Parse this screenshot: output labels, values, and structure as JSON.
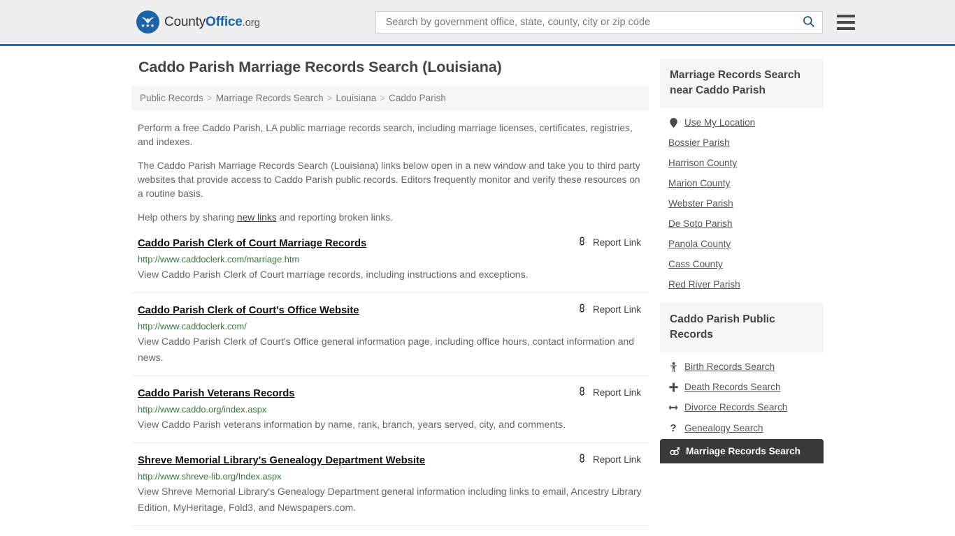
{
  "header": {
    "logo": {
      "icon": "eagle-shield-icon",
      "text_county": "County",
      "text_office": "Office",
      "text_org": ".org",
      "stars": "★★★"
    },
    "search": {
      "placeholder": "Search by government office, state, county, city or zip code",
      "value": "",
      "button_icon": "search-icon"
    },
    "menu_icon": "hamburger-menu-icon"
  },
  "page_title": "Caddo Parish Marriage Records Search (Louisiana)",
  "breadcrumb": {
    "separator": ">",
    "items": [
      {
        "label": "Public Records"
      },
      {
        "label": "Marriage Records Search"
      },
      {
        "label": "Louisiana"
      },
      {
        "label": "Caddo Parish"
      }
    ]
  },
  "intro": {
    "p1": "Perform a free Caddo Parish, LA public marriage records search, including marriage licenses, certificates, registries, and indexes.",
    "p2": "The Caddo Parish Marriage Records Search (Louisiana) links below open in a new window and take you to third party websites that provide access to Caddo Parish public records. Editors frequently monitor and verify these resources on a routine basis.",
    "p3_prefix": "Help others by sharing ",
    "p3_link": "new links",
    "p3_suffix": " and reporting broken links."
  },
  "report_link_label": "Report Link",
  "report_link_icon": "chain-broken-icon",
  "results": [
    {
      "title": "Caddo Parish Clerk of Court Marriage Records",
      "url": "http://www.caddoclerk.com/marriage.htm",
      "description": "View Caddo Parish Clerk of Court marriage records, including instructions and exceptions."
    },
    {
      "title": "Caddo Parish Clerk of Court's Office Website",
      "url": "http://www.caddoclerk.com/",
      "description": "View Caddo Parish Clerk of Court's Office general information page, including office hours, contact information and news."
    },
    {
      "title": "Caddo Parish Veterans Records",
      "url": "http://www.caddo.org/index.aspx",
      "description": "View Caddo Parish veterans information by name, rank, branch, years served, city, and comments."
    },
    {
      "title": "Shreve Memorial Library's Genealogy Department Website",
      "url": "http://www.shreve-lib.org/Index.aspx",
      "description": "View Shreve Memorial Library's Genealogy Department general information including links to email, Ancestry Library Edition, MyHeritage, Fold3, and Newspapers.com."
    }
  ],
  "sidebar": {
    "nearby": {
      "heading": "Marriage Records Search near Caddo Parish",
      "items": [
        {
          "label": "Use My Location",
          "icon": "map-pin-icon"
        },
        {
          "label": "Bossier Parish",
          "icon": ""
        },
        {
          "label": "Harrison County",
          "icon": ""
        },
        {
          "label": "Marion County",
          "icon": ""
        },
        {
          "label": "Webster Parish",
          "icon": ""
        },
        {
          "label": "De Soto Parish",
          "icon": ""
        },
        {
          "label": "Panola County",
          "icon": ""
        },
        {
          "label": "Cass County",
          "icon": ""
        },
        {
          "label": "Red River Parish",
          "icon": ""
        }
      ]
    },
    "public_records": {
      "heading": "Caddo Parish Public Records",
      "items": [
        {
          "label": "Birth Records Search",
          "icon": "child-icon",
          "glyph": "\u0001",
          "active": false
        },
        {
          "label": "Death Records Search",
          "icon": "plus-cross-icon",
          "glyph": "+",
          "active": false
        },
        {
          "label": "Divorce Records Search",
          "icon": "arrows-horizontal-icon",
          "glyph": "↔",
          "active": false
        },
        {
          "label": "Genealogy Search",
          "icon": "question-mark-icon",
          "glyph": "?",
          "active": false
        },
        {
          "label": "Marriage Records Search",
          "icon": "mars-venus-icon",
          "glyph": "⚥",
          "active": true
        }
      ]
    }
  },
  "colors": {
    "brand_blue": "#1c63a8",
    "header_border": "#2b6ca3",
    "header_bg": "#eeeeee",
    "url_green": "#3b7a41",
    "active_bg": "#3a3a3a"
  }
}
